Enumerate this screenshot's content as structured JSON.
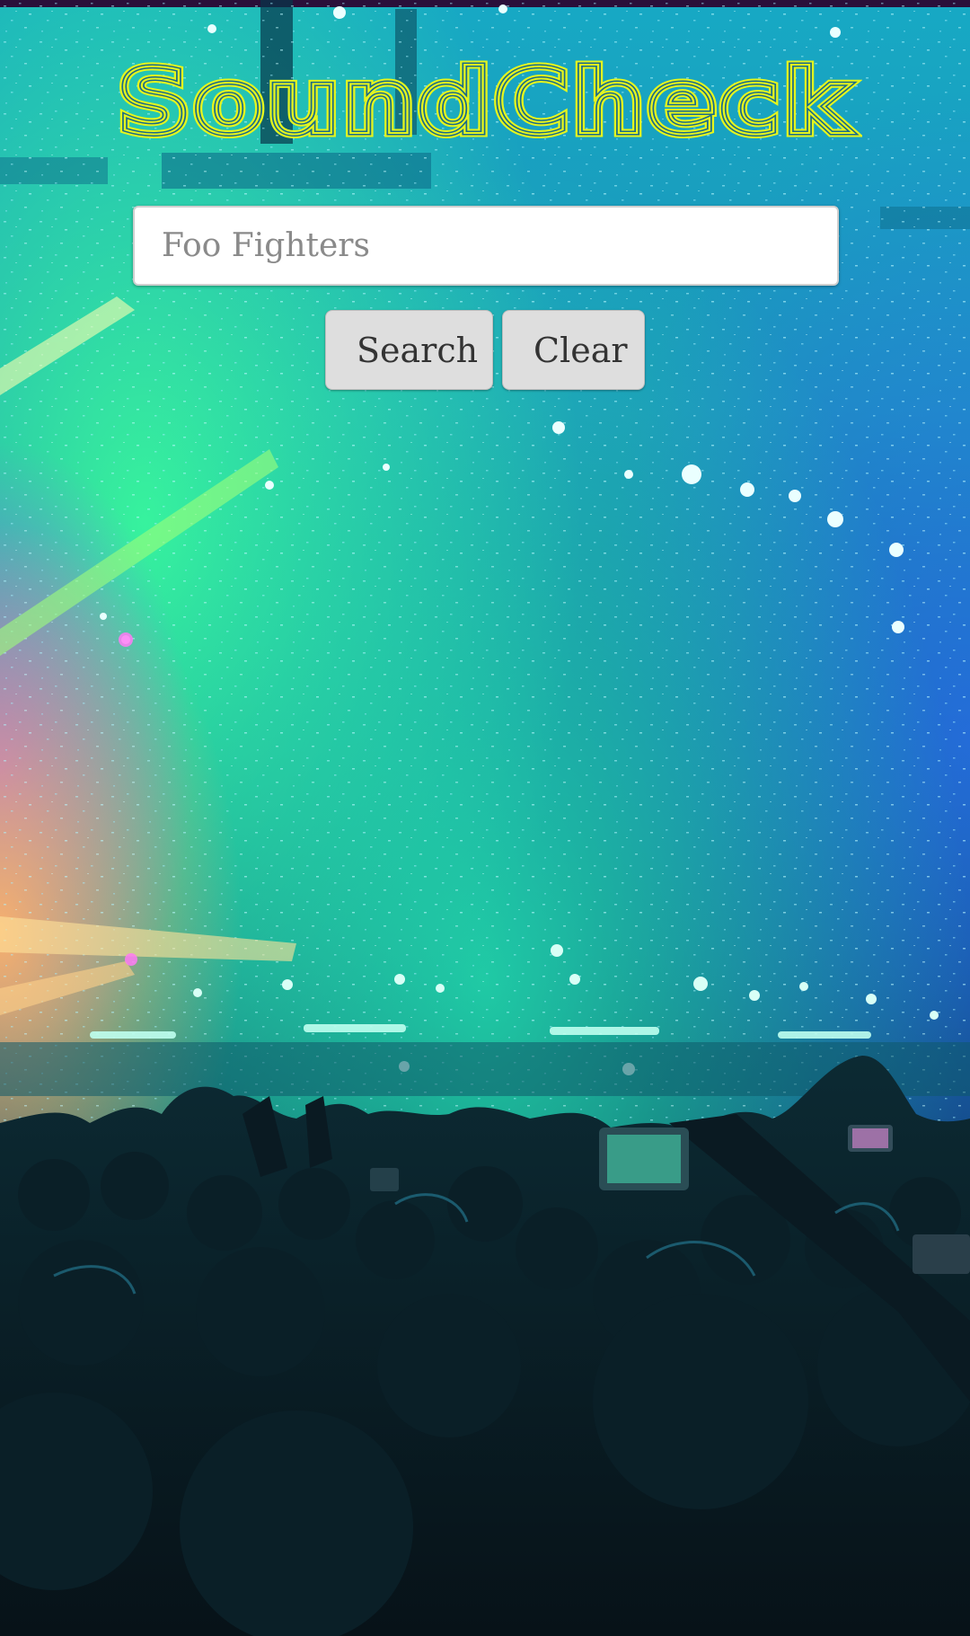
{
  "app": {
    "title": "SoundCheck",
    "title_color": "#e4f51e",
    "background": "concert-crowd-image"
  },
  "search": {
    "placeholder": "Foo Fighters",
    "value": ""
  },
  "buttons": {
    "search_label": "Search",
    "clear_label": "Clear"
  }
}
